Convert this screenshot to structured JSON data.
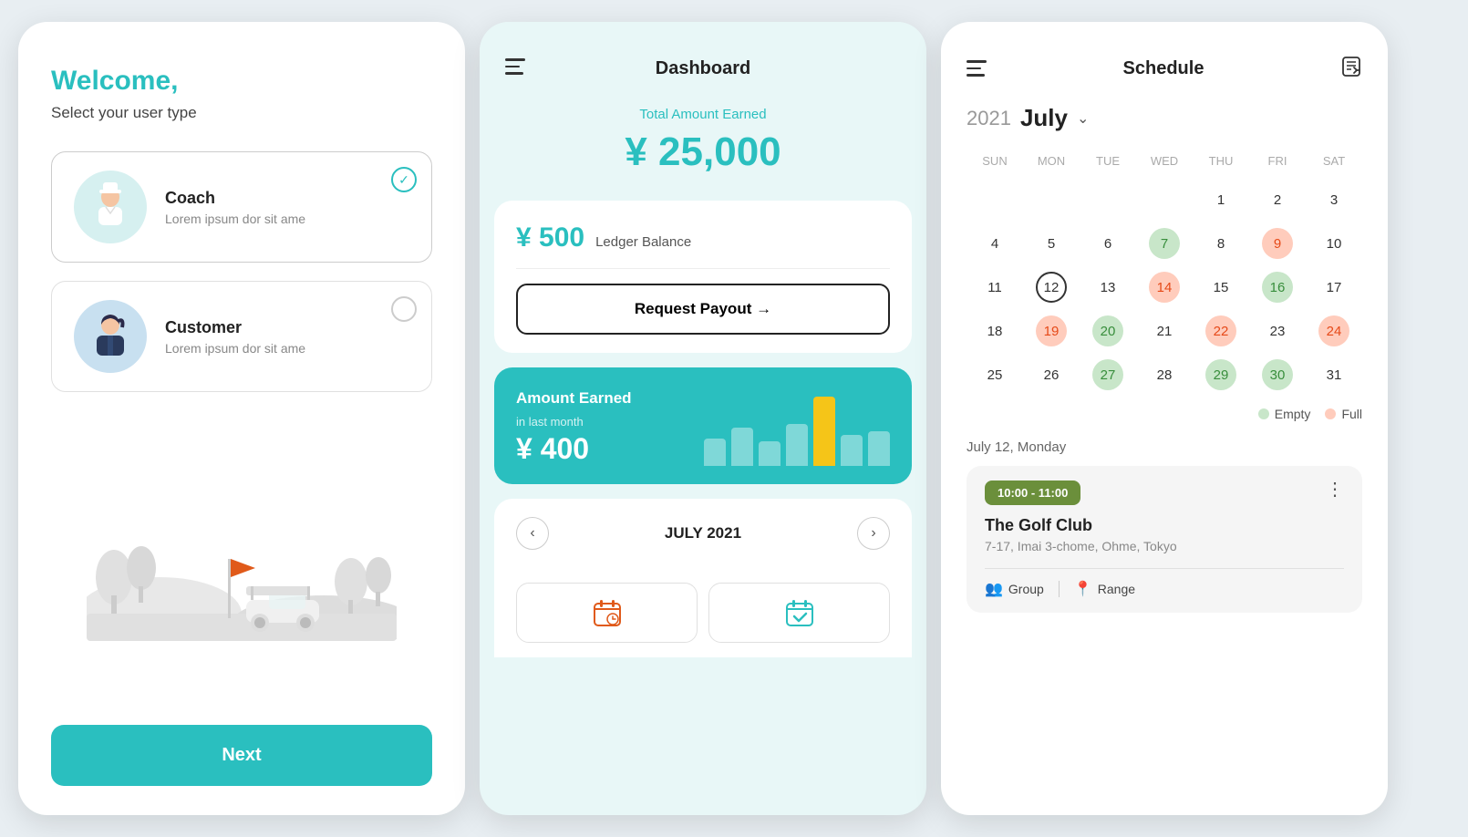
{
  "screen1": {
    "title": "Welcome,",
    "subtitle": "Select your user type",
    "users": [
      {
        "id": "coach",
        "name": "Coach",
        "desc": "Lorem ipsum dor sit ame",
        "selected": true
      },
      {
        "id": "customer",
        "name": "Customer",
        "desc": "Lorem ipsum dor sit ame",
        "selected": false
      }
    ],
    "next_label": "Next"
  },
  "screen2": {
    "title": "Dashboard",
    "earned_label": "Total Amount Earned",
    "big_amount": "¥ 25,000",
    "ledger_amount": "¥ 500",
    "ledger_label": "Ledger Balance",
    "payout_label": "Request Payout →",
    "card_title": "Amount Earned",
    "card_period": "in last month",
    "card_amount": "¥ 400",
    "calendar_title": "JULY 2021",
    "bars": [
      40,
      55,
      35,
      60,
      100,
      45,
      50
    ]
  },
  "screen3": {
    "title": "Schedule",
    "year": "2021",
    "month": "July",
    "day_labels": [
      "SUN",
      "MON",
      "TUE",
      "WED",
      "THU",
      "FRI",
      "SAT"
    ],
    "days": [
      {
        "num": "",
        "type": "empty"
      },
      {
        "num": "",
        "type": "empty"
      },
      {
        "num": "",
        "type": "empty"
      },
      {
        "num": "",
        "type": "empty"
      },
      {
        "num": "1",
        "type": "normal"
      },
      {
        "num": "2",
        "type": "normal"
      },
      {
        "num": "3",
        "type": "normal"
      },
      {
        "num": "4",
        "type": "normal"
      },
      {
        "num": "5",
        "type": "normal"
      },
      {
        "num": "6",
        "type": "normal"
      },
      {
        "num": "7",
        "type": "green"
      },
      {
        "num": "8",
        "type": "normal"
      },
      {
        "num": "9",
        "type": "pink"
      },
      {
        "num": "10",
        "type": "normal"
      },
      {
        "num": "11",
        "type": "normal"
      },
      {
        "num": "12",
        "type": "today"
      },
      {
        "num": "13",
        "type": "normal"
      },
      {
        "num": "14",
        "type": "pink"
      },
      {
        "num": "15",
        "type": "normal"
      },
      {
        "num": "16",
        "type": "green"
      },
      {
        "num": "17",
        "type": "normal"
      },
      {
        "num": "18",
        "type": "normal"
      },
      {
        "num": "19",
        "type": "pink"
      },
      {
        "num": "20",
        "type": "green"
      },
      {
        "num": "21",
        "type": "normal"
      },
      {
        "num": "22",
        "type": "pink"
      },
      {
        "num": "23",
        "type": "normal"
      },
      {
        "num": "24",
        "type": "pink"
      },
      {
        "num": "25",
        "type": "normal"
      },
      {
        "num": "26",
        "type": "normal"
      },
      {
        "num": "27",
        "type": "green"
      },
      {
        "num": "28",
        "type": "normal"
      },
      {
        "num": "29",
        "type": "green"
      },
      {
        "num": "30",
        "type": "green"
      },
      {
        "num": "31",
        "type": "normal"
      }
    ],
    "legend_empty": "Empty",
    "legend_full": "Full",
    "event_date": "July 12, Monday",
    "event_time": "10:00 - 11:00",
    "event_venue": "The Golf Club",
    "event_address": "7-17, Imai 3-chome, Ohme, Tokyo",
    "event_tag1": "Group",
    "event_tag2": "Range"
  }
}
